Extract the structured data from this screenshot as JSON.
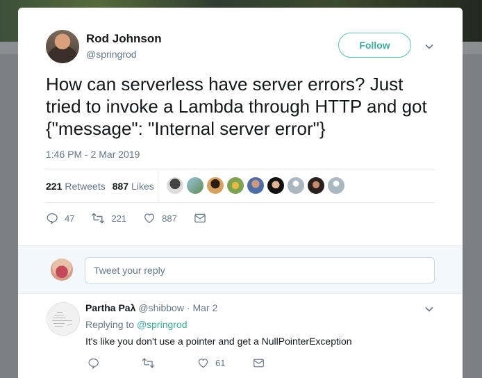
{
  "tweet": {
    "author_name": "Rod Johnson",
    "author_handle": "@springrod",
    "follow_label": "Follow",
    "text": "How can serverless have server errors?  Just tried to invoke a Lambda through HTTP and got {\"message\": \"Internal server error\"}",
    "timestamp": "1:46 PM - 2 Mar 2019",
    "retweets_count": "221",
    "retweets_label": "Retweets",
    "likes_count": "887",
    "likes_label": "Likes",
    "actions": {
      "reply_count": "47",
      "retweet_count": "221",
      "like_count": "887"
    }
  },
  "reply_box": {
    "placeholder": "Tweet your reply"
  },
  "reply_tweet": {
    "author_name": "Partha Paλ",
    "author_handle": "@shibbow",
    "date": "· Mar 2",
    "replying_prefix": "Replying to",
    "replying_to": "@springrod",
    "text": "It's like you don't use a pointer  and get a NullPointerException",
    "like_count": "61"
  },
  "colors": {
    "accent": "#3aa99a",
    "text": "#14171a",
    "muted": "#657786",
    "divider": "#e6ecf0"
  },
  "icons": [
    "chevron-down-icon",
    "reply-icon",
    "retweet-icon",
    "heart-icon",
    "message-icon"
  ]
}
